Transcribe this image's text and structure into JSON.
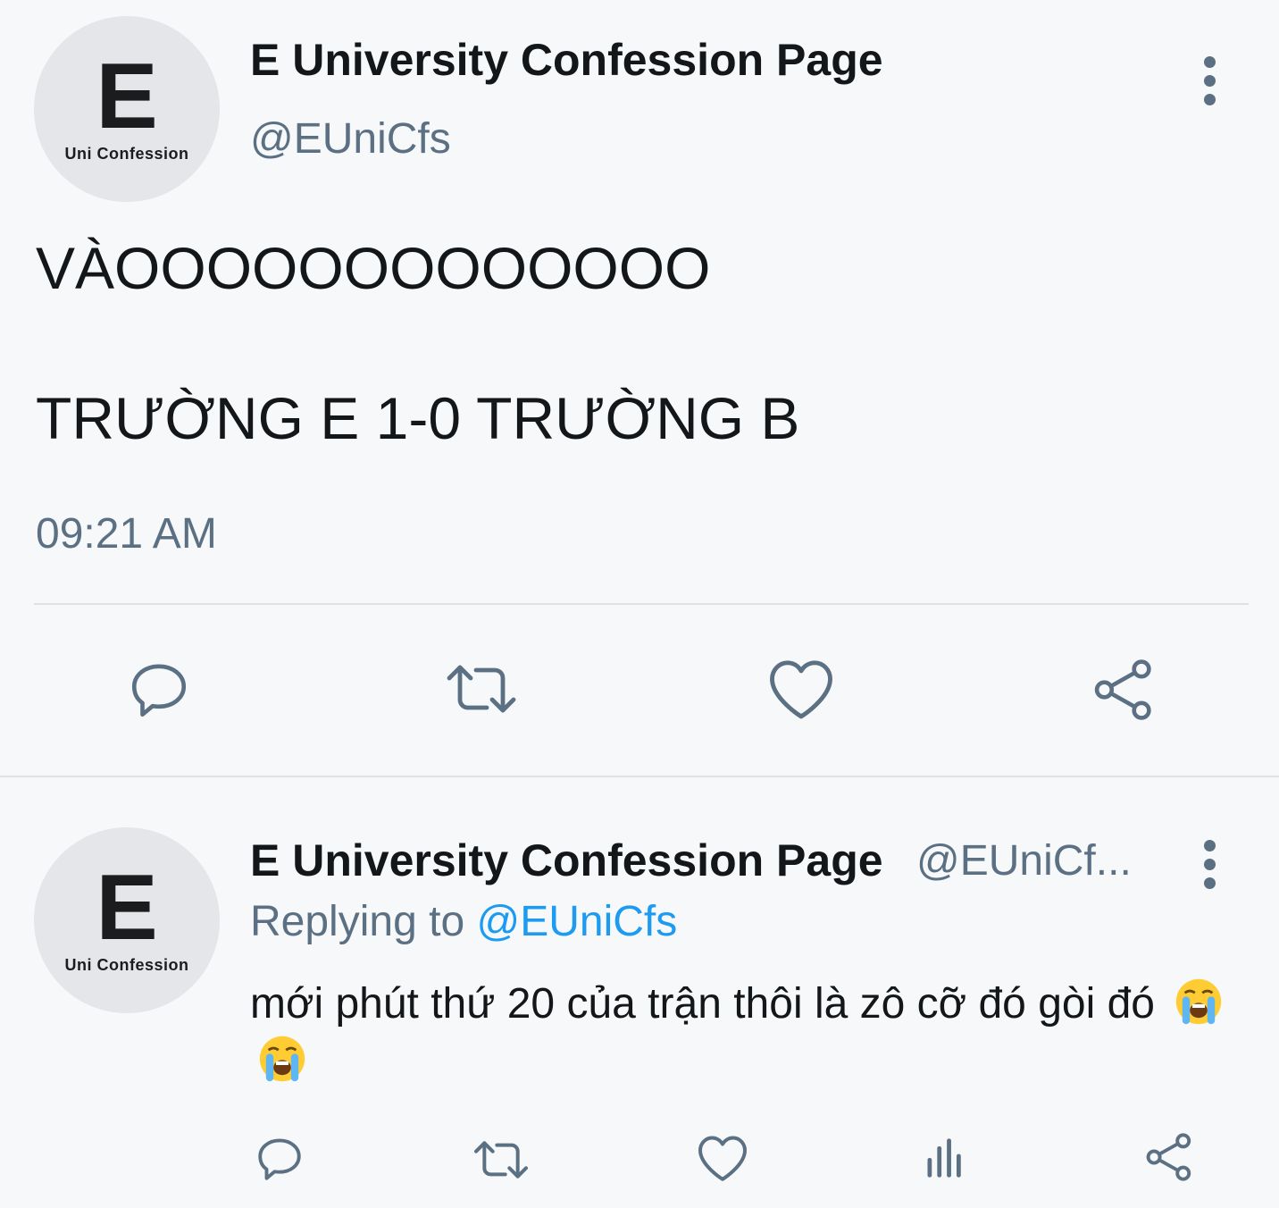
{
  "tweet": {
    "avatar": {
      "letter": "E",
      "caption": "Uni Confession"
    },
    "display_name": "E University Confession Page",
    "handle": "@EUniCfs",
    "text_line1": "VÀOOOOOOOOOOOOO",
    "text_line2": "TRƯỜNG E 1-0 TRƯỜNG B",
    "time": "09:21 AM",
    "actions": [
      "reply-icon",
      "retweet-icon",
      "like-icon",
      "share-icon"
    ]
  },
  "reply": {
    "avatar": {
      "letter": "E",
      "caption": "Uni Confession"
    },
    "display_name": "E University Confession Page",
    "handle": "@EUniCf...",
    "replying_prefix": "Replying to",
    "replying_handle": "@EUniCfs",
    "text": "mới phút thứ 20 của trận thôi là zô cỡ đó gòi đó",
    "emojis": [
      "loudly-crying-face",
      "loudly-crying-face"
    ],
    "actions": [
      "reply-icon",
      "retweet-icon",
      "like-icon",
      "analytics-icon",
      "share-icon"
    ]
  },
  "colors": {
    "text": "#14171a",
    "secondary": "#5b7083",
    "link": "#1d9bf0",
    "background": "#f7f8fa",
    "divider": "#dde2e6"
  }
}
